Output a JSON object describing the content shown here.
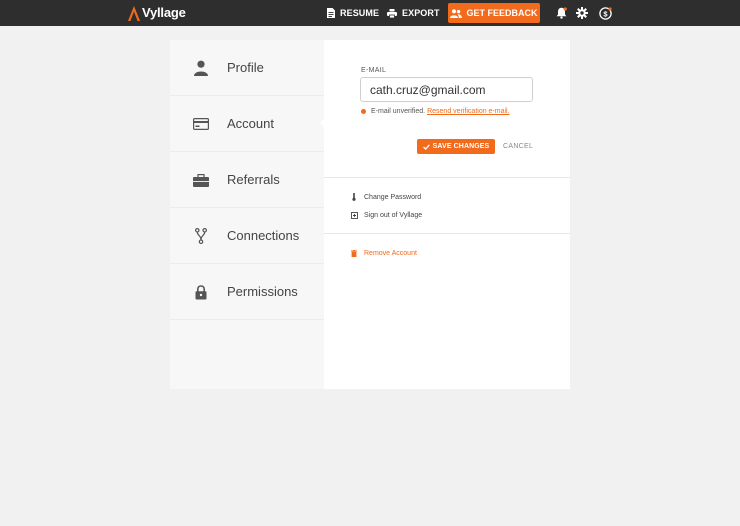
{
  "brand": {
    "name": "Vyllage",
    "accent": "#f26a1b"
  },
  "topbar": {
    "resume_label": "RESUME",
    "export_label": "EXPORT",
    "feedback_label": "GET FEEDBACK",
    "icons": [
      "bell-icon",
      "gear-icon",
      "coin-icon"
    ]
  },
  "sidebar": {
    "items": [
      {
        "label": "Profile",
        "icon": "user-icon"
      },
      {
        "label": "Account",
        "icon": "card-icon",
        "active": true
      },
      {
        "label": "Referrals",
        "icon": "briefcase-icon"
      },
      {
        "label": "Connections",
        "icon": "fork-icon"
      },
      {
        "label": "Permissions",
        "icon": "lock-icon"
      }
    ]
  },
  "account": {
    "email_label": "E-MAIL",
    "email_value": "cath.cruz@gmail.com",
    "unverified_text": "E-mail unverified.",
    "resend_link": "Resend verification e-mail.",
    "save_label": "SAVE CHANGES",
    "cancel_label": "CANCEL",
    "change_password": "Change Password",
    "sign_out": "Sign out of Vyllage",
    "remove_account": "Remove Account"
  }
}
